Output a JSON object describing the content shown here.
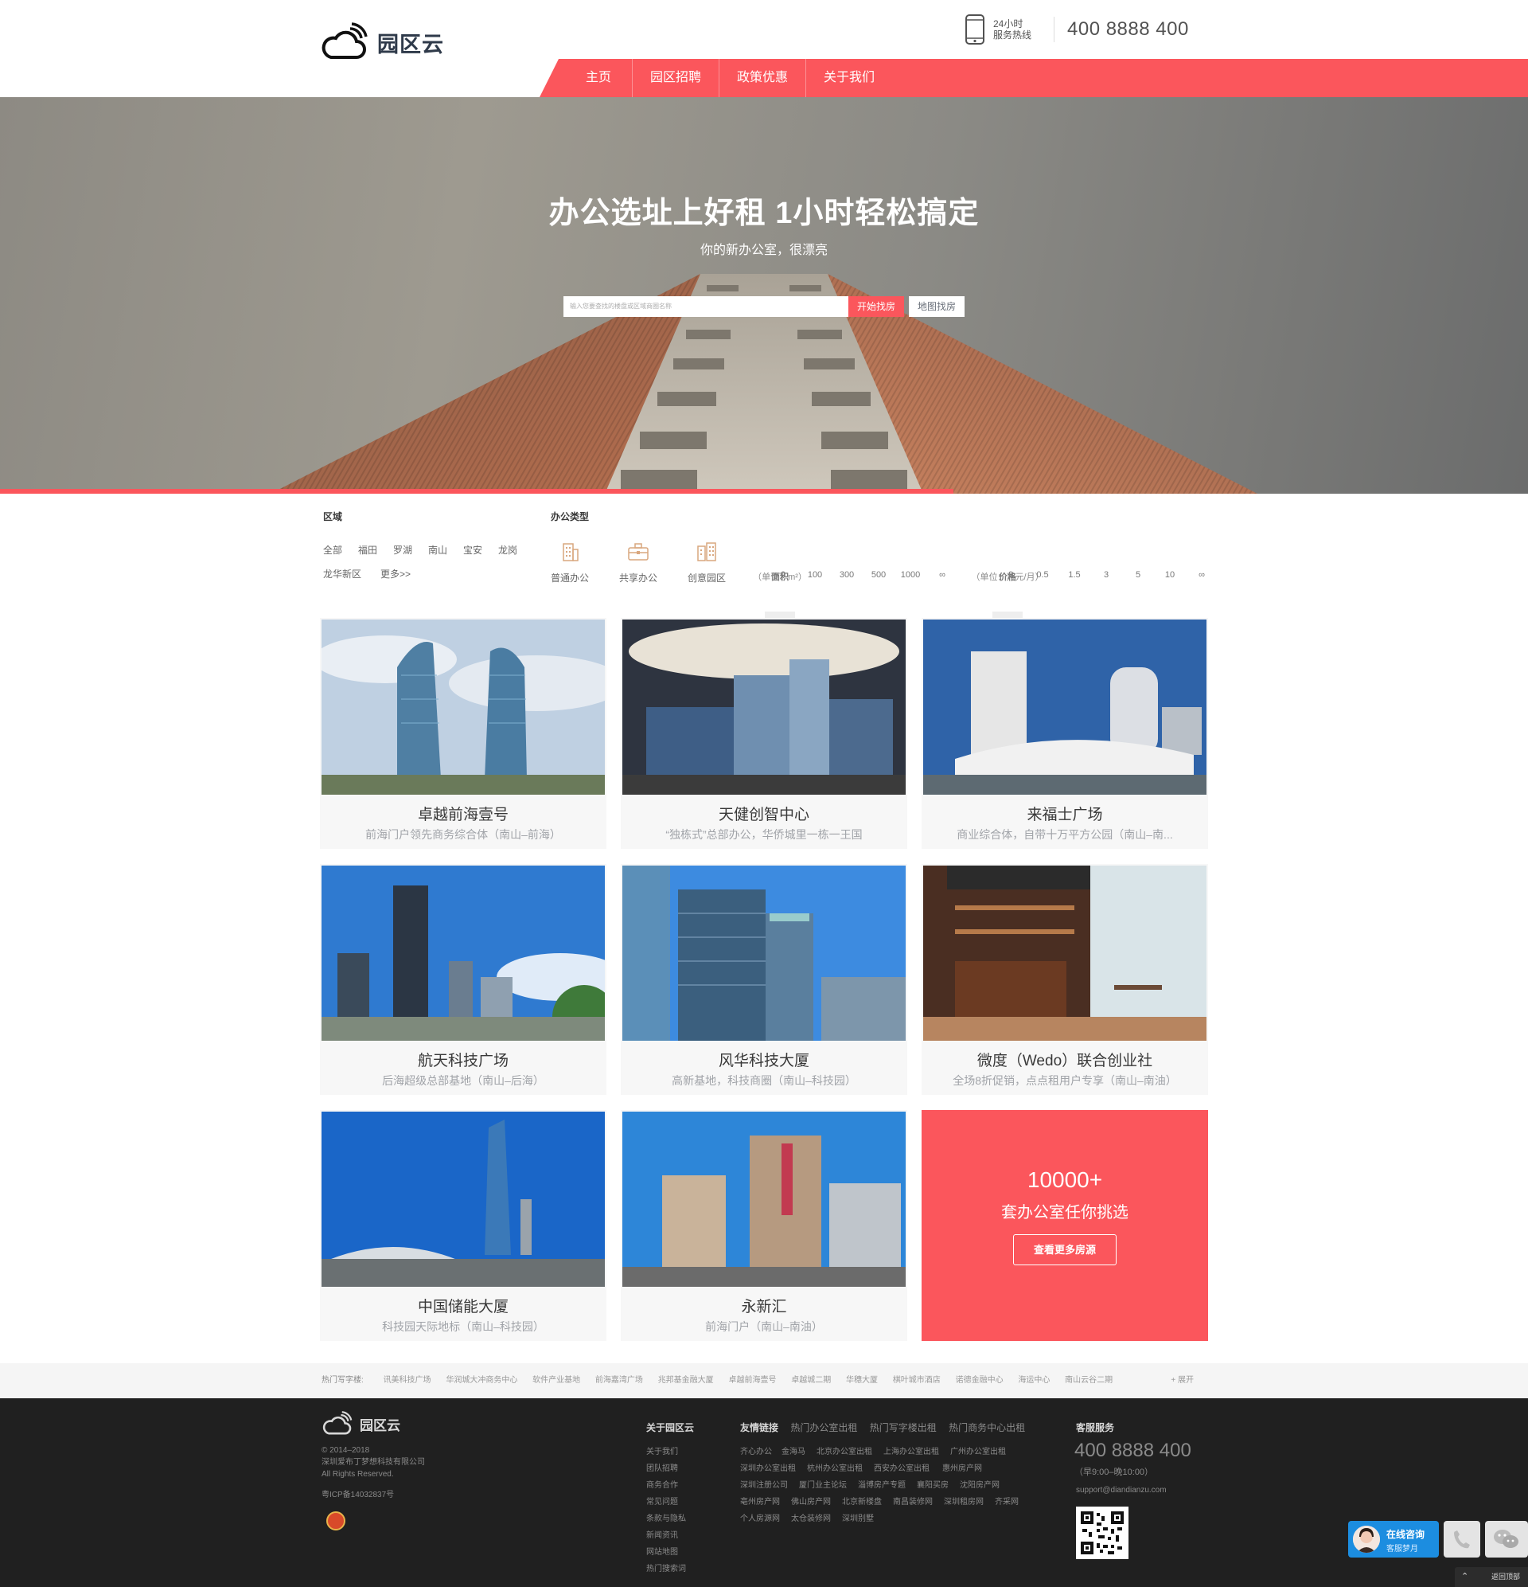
{
  "header": {
    "logo_text": "园区云",
    "hotline_line1": "24小时",
    "hotline_line2": "服务热线",
    "hotline_number": "400 8888 400",
    "nav": [
      "主页",
      "园区招聘",
      "政策优惠",
      "关于我们"
    ]
  },
  "hero": {
    "title": "办公选址上好租  1小时轻松搞定",
    "subtitle": "你的新办公室，很漂亮",
    "search_placeholder": "输入您要查找的楼盘或区域商圈名称",
    "search_button": "开始找房",
    "map_button": "地图找房"
  },
  "filters": {
    "region": {
      "title": "区域",
      "items": [
        "全部",
        "福田",
        "罗湖",
        "南山",
        "宝安",
        "龙岗",
        "龙华新区",
        "更多>>"
      ]
    },
    "office_type": {
      "title": "办公类型",
      "items": [
        {
          "label": "普通办公",
          "icon": "building-icon"
        },
        {
          "label": "共享办公",
          "icon": "briefcase-icon"
        },
        {
          "label": "创意园区",
          "icon": "park-icon"
        }
      ]
    },
    "area": {
      "title": "面积",
      "unit": "（单位：m²）",
      "ticks": [
        "0",
        "100",
        "300",
        "500",
        "1000",
        "∞"
      ]
    },
    "price": {
      "title": "价格",
      "unit": "（单位：万元/月）",
      "ticks": [
        "0",
        "0.5",
        "1.5",
        "3",
        "5",
        "10",
        "∞"
      ]
    }
  },
  "listings": [
    {
      "title": "卓越前海壹号",
      "desc": "前海门户领先商务综合体（南山–前海）"
    },
    {
      "title": "天健创智中心",
      "desc": "“独栋式”总部办公，华侨城里一栋一王国"
    },
    {
      "title": "来福士广场",
      "desc": "商业综合体，自带十万平方公园（南山–南..."
    },
    {
      "title": "航天科技广场",
      "desc": "后海超级总部基地（南山–后海）"
    },
    {
      "title": "风华科技大厦",
      "desc": "高新基地，科技商圈（南山–科技园）"
    },
    {
      "title": "微度（Wedo）联合创业社",
      "desc": "全场8折促销，点点租用户专享（南山–南油）"
    },
    {
      "title": "中国储能大厦",
      "desc": "科技园天际地标（南山–科技园）"
    },
    {
      "title": "永新汇",
      "desc": "前海门户（南山–南油）"
    }
  ],
  "promo": {
    "number": "10000+",
    "text": "套办公室任你挑选",
    "button": "查看更多房源"
  },
  "hot_buildings": {
    "label": "热门写字楼:",
    "items": [
      "讯美科技广场",
      "华润城大冲商务中心",
      "软件产业基地",
      "前海嘉湾广场",
      "兆邦基金融大厦",
      "卓越前海壹号",
      "卓越城二期",
      "华穗大厦",
      "棋叶城市酒店",
      "诺德金融中心",
      "海运中心",
      "南山云谷二期"
    ],
    "expand": "+ 展开"
  },
  "footer": {
    "logo_text": "园区云",
    "copyright": [
      "© 2014–2018",
      "深圳爱布丁梦想科技有限公司",
      "All Rights Reserved."
    ],
    "icp": "粤ICP备14032837号",
    "about": {
      "title": "关于园区云",
      "items": [
        "关于我们",
        "团队招聘",
        "商务合作",
        "常见问题",
        "条款与隐私",
        "新闻资讯",
        "网站地图",
        "热门搜索词"
      ]
    },
    "links": {
      "title": "友情链接",
      "tabs": [
        "热门办公室出租",
        "热门写字楼出租",
        "热门商务中心出租"
      ],
      "rows": [
        [
          "齐心办公",
          "金海马",
          "北京办公室出租",
          "上海办公室出租",
          "广州办公室出租"
        ],
        [
          "深圳办公室出租",
          "杭州办公室出租",
          "西安办公室出租",
          "惠州房产网"
        ],
        [
          "深圳注册公司",
          "厦门业主论坛",
          "淄博房产专题",
          "襄阳买房",
          "沈阳房产网"
        ],
        [
          "亳州房产网",
          "佛山房产网",
          "北京新楼盘",
          "南昌装修网",
          "深圳租房网",
          "齐采网"
        ],
        [
          "个人房源网",
          "太仓装修网",
          "深圳别墅"
        ]
      ]
    },
    "service": {
      "title": "客服服务",
      "number": "400 8888 400",
      "hours": "（早9:00–晚10:00）",
      "email": "support@diandianzu.com"
    }
  },
  "floating": {
    "consult_title": "在线咨询",
    "consult_sub": "客服梦月",
    "back_top": "返回顶部"
  },
  "colors": {
    "accent": "#fb565c",
    "text_dark": "#393939",
    "text_muted": "#A0A3A8",
    "hotline": "#525252",
    "footer_bg": "#202020"
  }
}
